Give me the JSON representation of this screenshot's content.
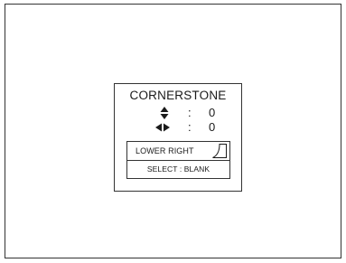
{
  "osd": {
    "title": "CORNERSTONE",
    "vertical": {
      "icon": "up-down-arrow-icon",
      "separator": ":",
      "value": "0"
    },
    "horizontal": {
      "icon": "left-right-arrow-icon",
      "separator": ":",
      "value": "0"
    },
    "position": {
      "label": "LOWER RIGHT",
      "icon": "corner-lower-right-icon"
    },
    "select": {
      "label": "SELECT : BLANK"
    }
  }
}
